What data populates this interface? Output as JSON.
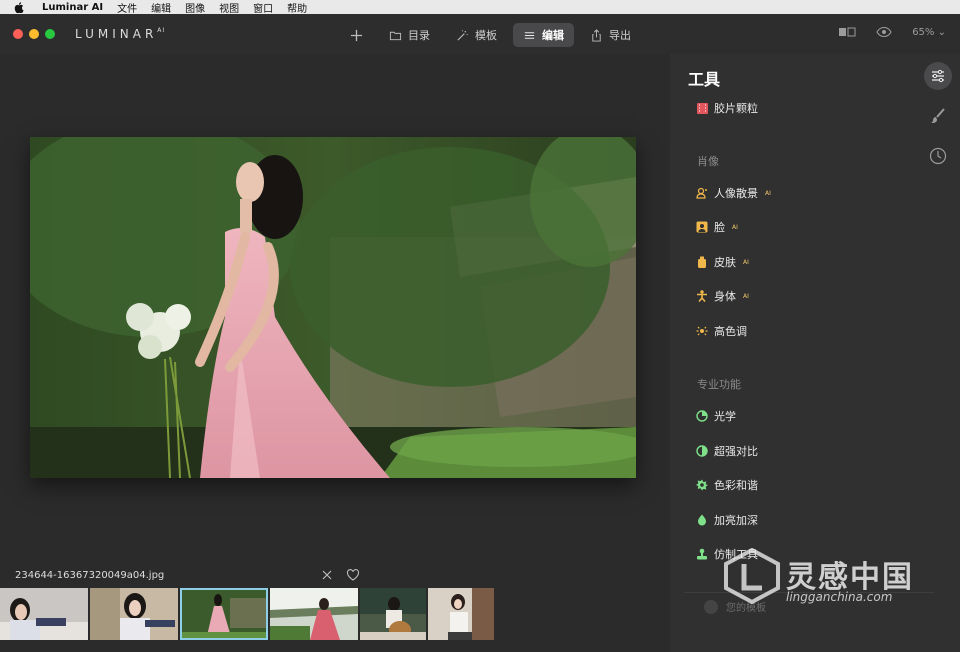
{
  "menubar": {
    "app": "Luminar AI",
    "items": [
      "文件",
      "编辑",
      "图像",
      "视图",
      "窗口",
      "帮助"
    ]
  },
  "titlebar": {
    "logo": "LUMINAR",
    "logo_sup": "AI",
    "tabs": [
      {
        "label": "目录",
        "icon": "folder-icon"
      },
      {
        "label": "模板",
        "icon": "magic-wand-icon"
      },
      {
        "label": "编辑",
        "icon": "sliders-icon",
        "active": true
      },
      {
        "label": "导出",
        "icon": "share-icon"
      }
    ],
    "zoom": "65%"
  },
  "canvas": {
    "filename": "234644-16367320049a04.jpg"
  },
  "sidebar": {
    "title": "工具",
    "top_tool": "胶片颗粒",
    "section_portrait": "肖像",
    "portrait_tools": [
      {
        "label": "人像散景",
        "ai": "AI",
        "icon": "portrait-bokeh-icon",
        "color": "#f0b74a"
      },
      {
        "label": "脸",
        "ai": "AI",
        "icon": "face-icon",
        "color": "#f0b74a"
      },
      {
        "label": "皮肤",
        "ai": "AI",
        "icon": "skin-icon",
        "color": "#f0b74a"
      },
      {
        "label": "身体",
        "ai": "AI",
        "icon": "body-icon",
        "color": "#f0b74a"
      },
      {
        "label": "高色调",
        "ai": "",
        "icon": "high-key-icon",
        "color": "#f0b74a"
      }
    ],
    "section_pro": "专业功能",
    "pro_tools": [
      {
        "label": "光学",
        "icon": "optics-icon",
        "color": "#7fe08a"
      },
      {
        "label": "超强对比",
        "icon": "contrast-icon",
        "color": "#7fe08a"
      },
      {
        "label": "色彩和谐",
        "icon": "color-harmony-icon",
        "color": "#7fe08a"
      },
      {
        "label": "加亮加深",
        "icon": "dodge-burn-icon",
        "color": "#7fe08a"
      },
      {
        "label": "仿制工具",
        "icon": "clone-icon",
        "color": "#7fe08a"
      }
    ],
    "bottom_label": "您的模板"
  },
  "watermark": {
    "line1": "灵感中国",
    "line2": "lingganchina.com"
  },
  "colors": {
    "accent_selected": "#8ecfe8",
    "red": "#fe5f57",
    "yellow": "#febc2e",
    "green": "#28c840"
  }
}
